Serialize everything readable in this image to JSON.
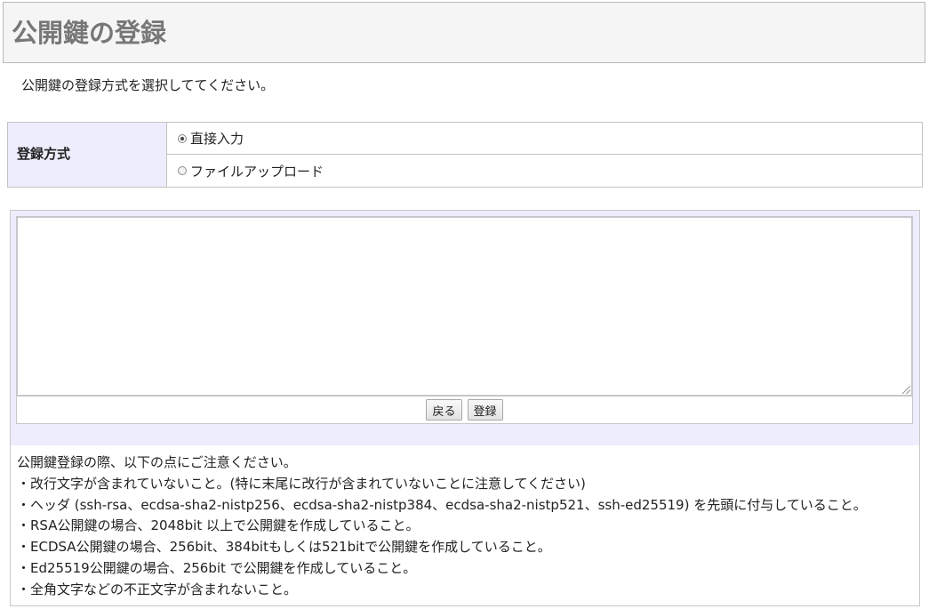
{
  "page": {
    "title": "公開鍵の登録",
    "instruction": "公開鍵の登録方式を選択しててください。"
  },
  "method": {
    "label": "登録方式",
    "options": [
      {
        "label": "直接入力",
        "checked": true
      },
      {
        "label": "ファイルアップロード",
        "checked": false
      }
    ]
  },
  "editor": {
    "value": "",
    "buttons": {
      "back": "戻る",
      "register": "登録"
    }
  },
  "notes": {
    "heading": "公開鍵登録の際、以下の点にご注意ください。",
    "items": [
      "・改行文字が含まれていないこと。(特に末尾に改行が含まれていないことに注意してください)",
      "・ヘッダ (ssh-rsa、ecdsa-sha2-nistp256、ecdsa-sha2-nistp384、ecdsa-sha2-nistp521、ssh-ed25519) を先頭に付与していること。",
      "・RSA公開鍵の場合、2048bit 以上で公開鍵を作成していること。",
      "・ECDSA公開鍵の場合、256bit、384bitもしくは521bitで公開鍵を作成していること。",
      "・Ed25519公開鍵の場合、256bit で公開鍵を作成していること。",
      "・全角文字などの不正文字が含まれないこと。"
    ]
  },
  "colors": {
    "label_bg": "#ededfd",
    "title_text": "#777777",
    "border": "#c4c4c4"
  }
}
